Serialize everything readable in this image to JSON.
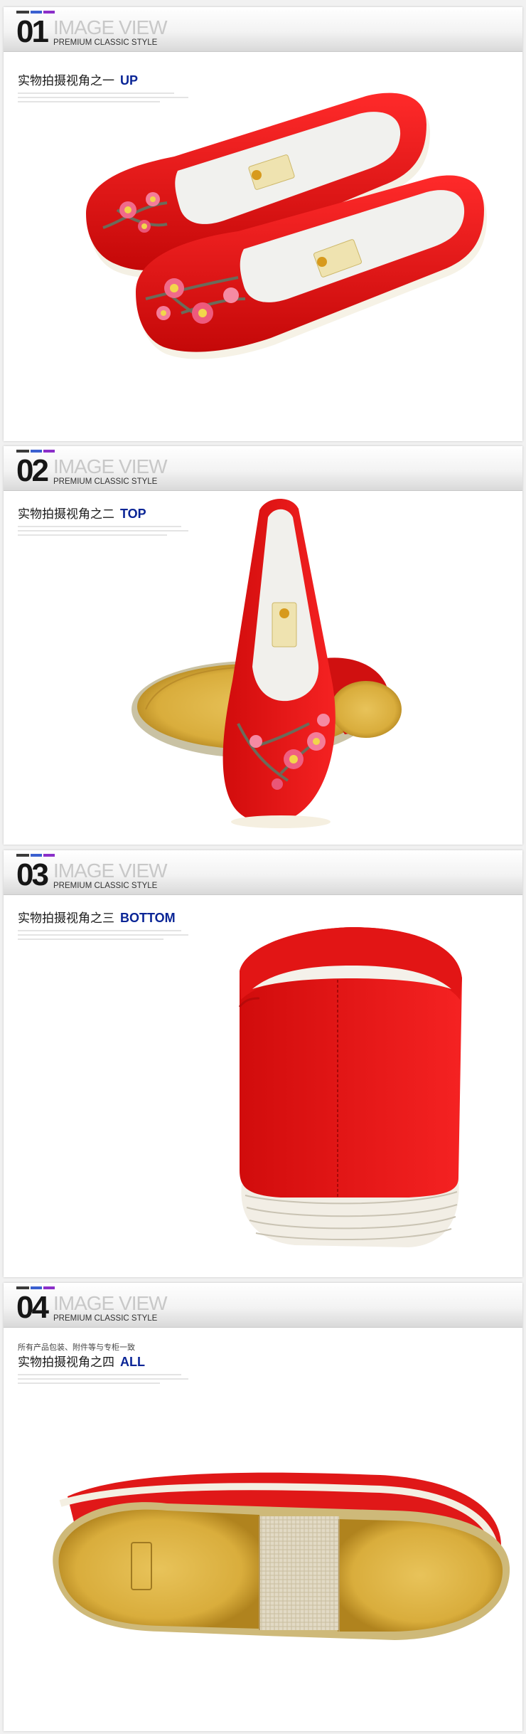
{
  "colors": {
    "accent_blue": "#0a2596",
    "bar_dark": "#3b3b3b",
    "bar_blue": "#3a5fcf",
    "bar_purple": "#8b2fc9"
  },
  "sections": [
    {
      "number": "01",
      "title": "IMAGE VIEW",
      "subtitle": "PREMIUM CLASSIC STYLE",
      "caption_cn": "实物拍摄视角之一",
      "caption_en": "UP"
    },
    {
      "number": "02",
      "title": "IMAGE VIEW",
      "subtitle": "PREMIUM CLASSIC STYLE",
      "caption_cn": "实物拍摄视角之二",
      "caption_en": "TOP"
    },
    {
      "number": "03",
      "title": "IMAGE VIEW",
      "subtitle": "PREMIUM CLASSIC STYLE",
      "caption_cn": "实物拍摄视角之三",
      "caption_en": "BOTTOM"
    },
    {
      "number": "04",
      "title": "IMAGE VIEW",
      "subtitle": "PREMIUM CLASSIC STYLE",
      "note": "所有产品包装、附件等与专柜一致",
      "caption_cn": "实物拍摄视角之四",
      "caption_en": "ALL"
    }
  ]
}
